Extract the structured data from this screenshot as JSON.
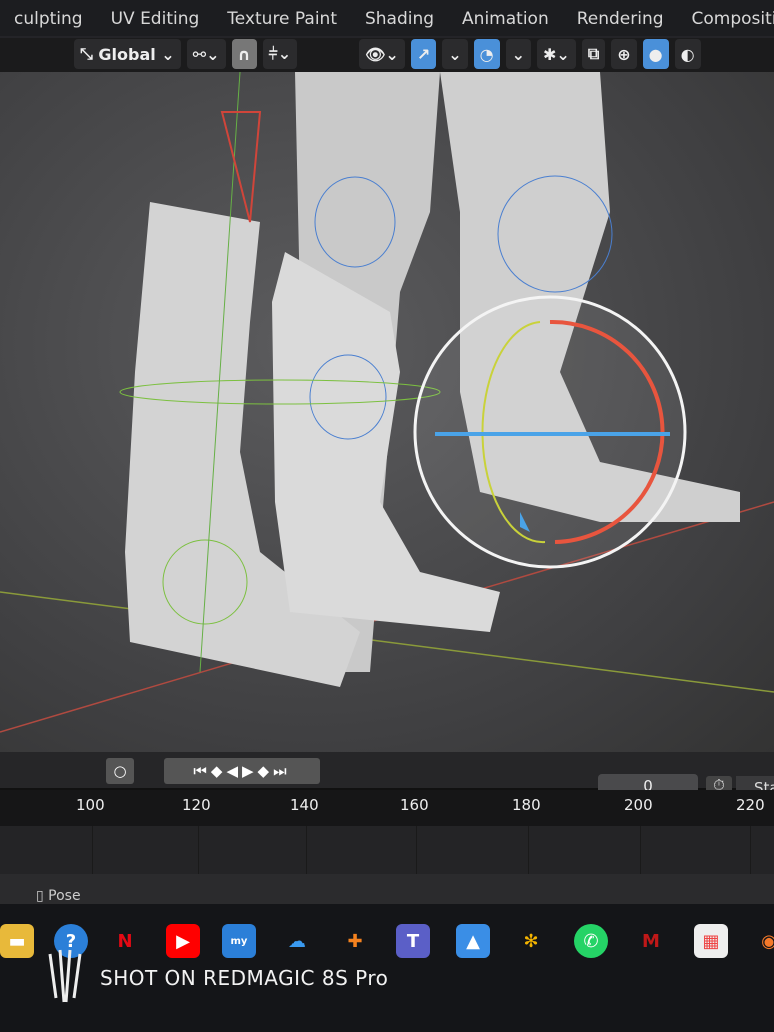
{
  "workspace_tabs": [
    "culpting",
    "UV Editing",
    "Texture Paint",
    "Shading",
    "Animation",
    "Rendering",
    "Compositing"
  ],
  "toolbar": {
    "orientation": "Global"
  },
  "timeline": {
    "current_frame": "0",
    "start_label": "Sta",
    "ruler": [
      "100",
      "120",
      "140",
      "160",
      "180",
      "200",
      "220"
    ]
  },
  "status": {
    "mode": "Pose"
  },
  "taskbar": {
    "icons": [
      "file-explorer",
      "help",
      "netflix",
      "youtube",
      "myhp",
      "onedrive",
      "app-orange",
      "teams",
      "photos",
      "pinwheel",
      "whatsapp",
      "mcafee",
      "store",
      "blender"
    ]
  },
  "watermark": "SHOT ON REDMAGIC 8S Pro",
  "colors": {
    "accent": "#4a90d9",
    "x_axis": "#d9473b",
    "y_axis": "#8bc34a"
  }
}
